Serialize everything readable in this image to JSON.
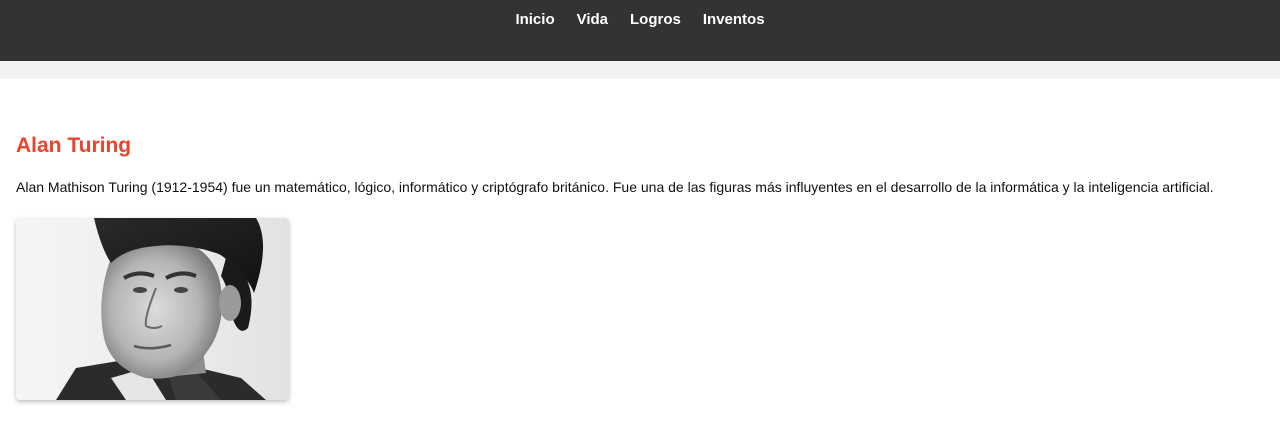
{
  "nav": {
    "items": [
      {
        "label": "Inicio"
      },
      {
        "label": "Vida"
      },
      {
        "label": "Logros"
      },
      {
        "label": "Inventos"
      }
    ]
  },
  "main": {
    "heading": "Alan Turing",
    "description": "Alan Mathison Turing (1912-1954) fue un matemático, lógico, informático y criptógrafo británico. Fue una de las figuras más influyentes en el desarrollo de la informática y la inteligencia artificial.",
    "photo_alt": "Alan Turing"
  },
  "colors": {
    "header_bg": "#333333",
    "strip_bg": "#f2f2f2",
    "accent": "#e8452c",
    "nav_text": "#ffffff"
  }
}
